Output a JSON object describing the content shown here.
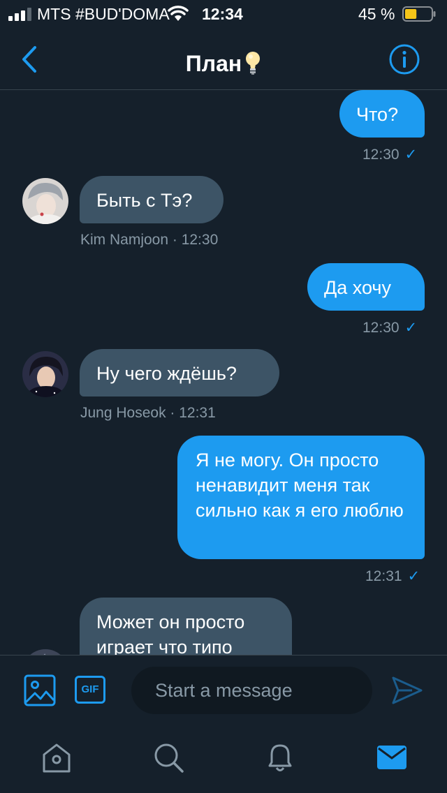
{
  "status_bar": {
    "carrier": "MTS #BUD'DOMA",
    "time": "12:34",
    "battery_percent": "45 %",
    "battery_level": 0.45
  },
  "header": {
    "title": "План"
  },
  "messages": [
    {
      "direction": "out",
      "text": "Что?",
      "time": "12:30",
      "read": true
    },
    {
      "direction": "in",
      "text": "Быть с Тэ?",
      "sender": "Kim Namjoon",
      "time": "12:30",
      "meta": "Kim Namjoon · 12:30"
    },
    {
      "direction": "out",
      "text": "Да хочу",
      "time": "12:30",
      "read": true
    },
    {
      "direction": "in",
      "text": "Ну чего ждёшь?",
      "sender": "Jung Hoseok",
      "time": "12:31",
      "meta": "Jung Hoseok · 12:31"
    },
    {
      "direction": "out",
      "text": "Я не могу. Он просто ненавидит меня так сильно как я его люблю",
      "time": "12:31",
      "read": true
    },
    {
      "direction": "in",
      "text": "Может он просто играет что типо"
    }
  ],
  "composer": {
    "gif_label": "GIF",
    "placeholder": "Start a message"
  },
  "colors": {
    "background": "#15202b",
    "accent": "#1d9bf0",
    "incoming_bubble": "#3d5466",
    "muted_text": "#8899a6"
  },
  "icons": {
    "back": "chevron-left-icon",
    "info": "info-circle-icon",
    "title_emoji": "lightbulb-icon",
    "image": "image-icon",
    "send": "send-icon",
    "tabs": [
      "home-icon",
      "search-icon",
      "bell-icon",
      "mail-icon"
    ]
  }
}
